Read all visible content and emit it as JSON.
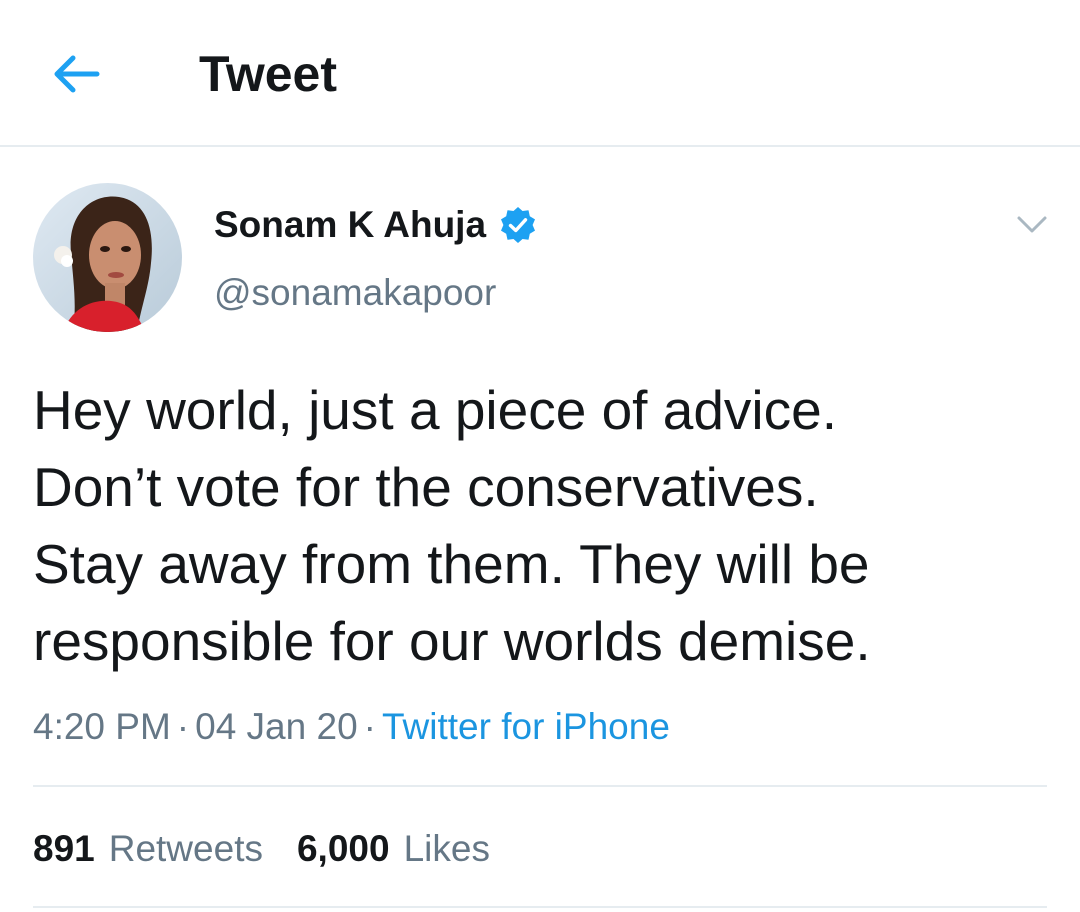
{
  "header": {
    "title": "Tweet",
    "back_icon": "arrow-left-icon"
  },
  "accent_color": "#1da1f2",
  "tweet": {
    "author": {
      "display_name": "Sonam K Ahuja",
      "handle": "@sonamakapoor",
      "verified": true
    },
    "text_lines": [
      "Hey world, just a piece of advice.",
      "Don’t vote for the conservatives.",
      "Stay away from them. They will be",
      "responsible for our worlds demise."
    ],
    "time": "4:20 PM",
    "date": "04 Jan 20",
    "separator": "·",
    "source": "Twitter for iPhone",
    "stats": {
      "retweets_count": "891",
      "retweets_label": "Retweets",
      "likes_count": "6,000",
      "likes_label": "Likes"
    }
  }
}
